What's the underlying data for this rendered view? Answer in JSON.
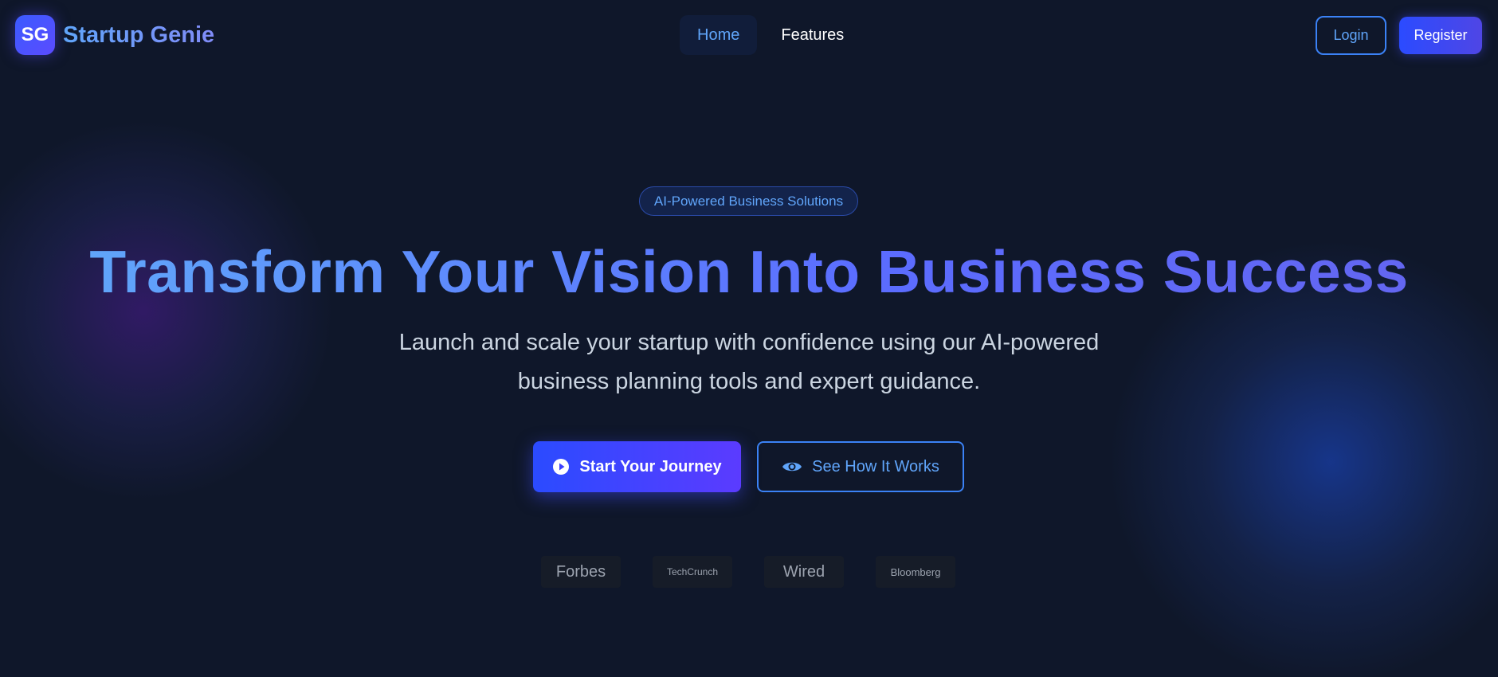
{
  "brand": {
    "logo_text": "SG",
    "name": "Startup Genie"
  },
  "nav": {
    "items": [
      {
        "label": "Home",
        "active": true
      },
      {
        "label": "Features",
        "active": false
      }
    ]
  },
  "auth": {
    "login_label": "Login",
    "register_label": "Register"
  },
  "hero": {
    "badge": "AI-Powered Business Solutions",
    "title": "Transform Your Vision Into Business Success",
    "subtitle_line1": "Launch and scale your startup with confidence using our AI-powered",
    "subtitle_line2": "business planning tools and expert guidance.",
    "primary_cta": {
      "label": "Start Your Journey",
      "icon": "play-circle-icon"
    },
    "secondary_cta": {
      "label": "See How It Works",
      "icon": "eye-icon"
    }
  },
  "press": [
    "Forbes",
    "TechCrunch",
    "Wired",
    "Bloomberg"
  ],
  "colors": {
    "background": "#0f172a",
    "accent_blue": "#3b82f6",
    "accent_light_blue": "#60a5fa",
    "accent_indigo": "#4f46e5",
    "subtitle_text": "#cbd5e1",
    "press_text": "#9ca3af"
  }
}
